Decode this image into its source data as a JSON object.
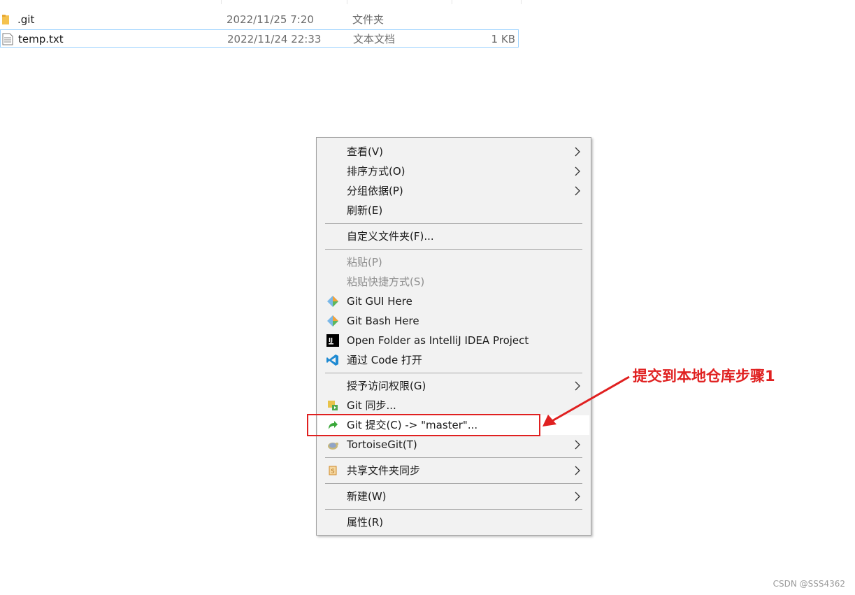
{
  "files": [
    {
      "name": ".git",
      "date": "2022/11/25 7:20",
      "type": "文件夹",
      "size": "",
      "icon": "folder-icon"
    },
    {
      "name": "temp.txt",
      "date": "2022/11/24 22:33",
      "type": "文本文档",
      "size": "1 KB",
      "icon": "text-file-icon"
    }
  ],
  "menu": {
    "view": "查看(V)",
    "sort": "排序方式(O)",
    "group": "分组依据(P)",
    "refresh": "刷新(E)",
    "customize": "自定义文件夹(F)...",
    "paste": "粘贴(P)",
    "paste_shortcut": "粘贴快捷方式(S)",
    "git_gui": "Git GUI Here",
    "git_bash": "Git Bash Here",
    "intellij": "Open Folder as IntelliJ IDEA Project",
    "vscode": "通过 Code 打开",
    "grant_access": "授予访问权限(G)",
    "git_sync": "Git 同步...",
    "git_commit": "Git 提交(C) -> \"master\"...",
    "tortoisegit": "TortoiseGit(T)",
    "share_sync": "共享文件夹同步",
    "new": "新建(W)",
    "properties": "属性(R)"
  },
  "annotation": {
    "text": "提交到本地仓库步骤1",
    "color": "#e02020"
  },
  "watermark": "CSDN @SSS4362",
  "colors": {
    "menu_bg": "#f2f2f2",
    "selection_border": "#99d1ff",
    "disabled_text": "#8e8e8e"
  }
}
